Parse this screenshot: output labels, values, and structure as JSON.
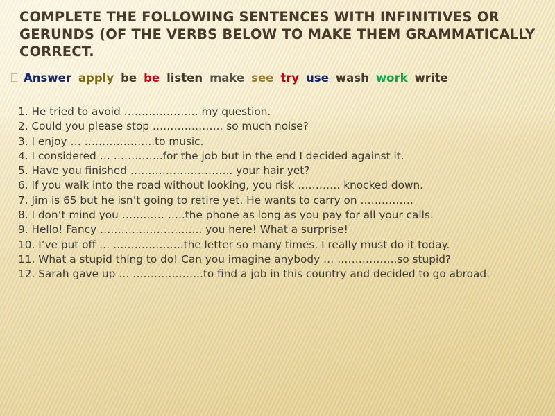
{
  "slide": {
    "title": "COMPLETE THE FOLLOWING SENTENCES WITH INFINITIVES OR GERUNDS (OF THE VERBS BELOW TO MAKE THEM GRAMMATICALLY CORRECT.",
    "background_color": "#f3e9c4",
    "title_color": "#48392a",
    "body_color": "#3b3a32"
  },
  "word_bank": {
    "bullet_icon": "square-bullet-icon",
    "words": [
      {
        "text": "Answer",
        "color": "#15256e"
      },
      {
        "text": "apply",
        "color": "#7a6a13"
      },
      {
        "text": "be",
        "color": "#4a3c2c"
      },
      {
        "text": "be",
        "color": "#d00018"
      },
      {
        "text": "listen",
        "color": "#46392c"
      },
      {
        "text": "make",
        "color": "#5a5248"
      },
      {
        "text": "see",
        "color": "#9a7c30"
      },
      {
        "text": "try",
        "color": "#b4000e"
      },
      {
        "text": "use",
        "color": "#16246c"
      },
      {
        "text": "wash",
        "color": "#463a2c"
      },
      {
        "text": "work",
        "color": "#15a34a"
      },
      {
        "text": "write",
        "color": "#46392c"
      }
    ]
  },
  "exercises": {
    "items": [
      "1. He tried to avoid ………………… my question.",
      "2. Could you please stop ……………….. so much noise?",
      "3. I enjoy … ………………..to music.",
      "4. I considered … …………..for the job but in the end I decided against it.",
      "5. Have you finished ……………………….. your hair yet?",
      "6. If you walk into the road without looking, you risk ………… knocked down.",
      "7. Jim is 65 but he isn’t going to retire yet. He wants to carry on ……………",
      "8. I don’t mind you ………… …..the phone as long as you pay for all your calls.",
      "9. Hello! Fancy ……………………….. you here! What a surprise!",
      "10. I’ve put off … ………………..the letter so many times. I really must do it today.",
      "11. What a stupid thing to do! Can you imagine anybody … ……………..so stupid?",
      "12. Sarah gave up … ………………..to find a job in this country and decided to go abroad."
    ]
  }
}
